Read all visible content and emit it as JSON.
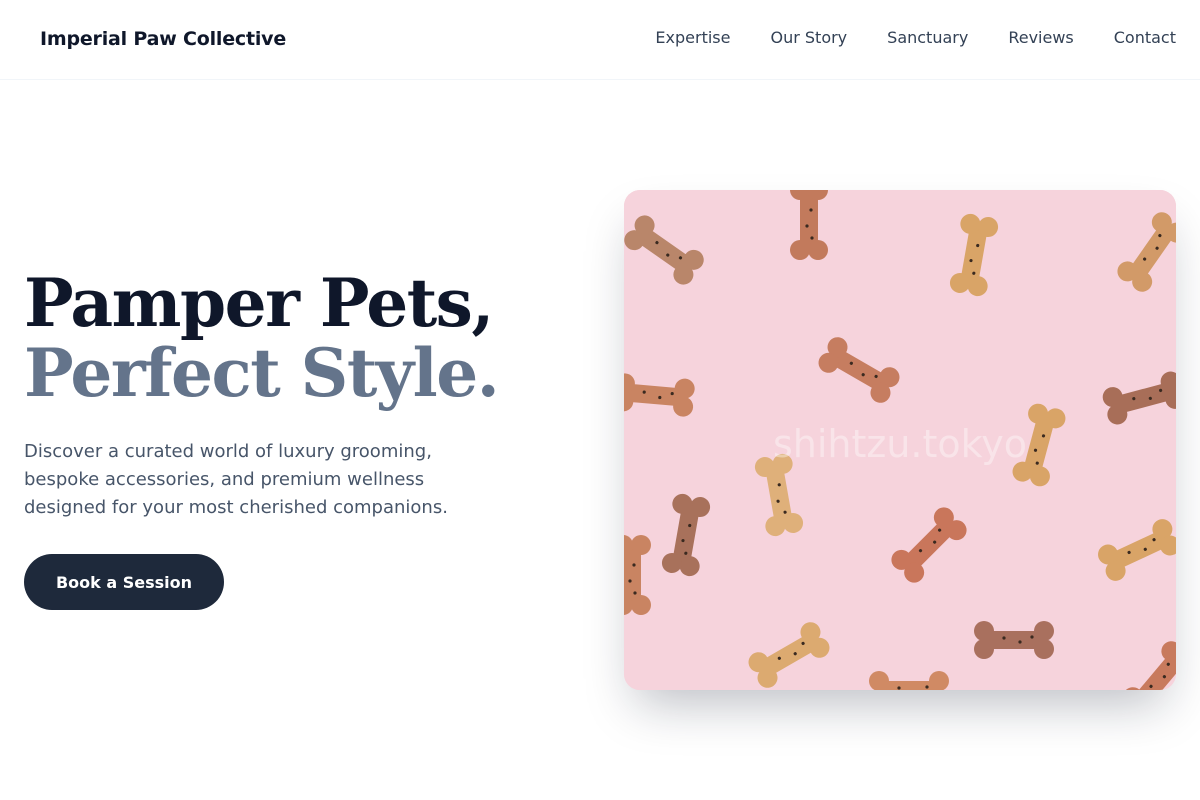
{
  "nav": {
    "brand": "Imperial Paw Collective",
    "links": [
      {
        "label": "Expertise"
      },
      {
        "label": "Our Story"
      },
      {
        "label": "Sanctuary"
      },
      {
        "label": "Reviews"
      },
      {
        "label": "Contact"
      }
    ]
  },
  "hero": {
    "title_line1": "Pamper Pets,",
    "title_line2": "Perfect Style.",
    "description": "Discover a curated world of luxury grooming, bespoke accessories, and premium wellness designed for your most cherished companions.",
    "cta_label": "Book a Session",
    "image": {
      "alt": "Dog bone biscuits scattered on a pink background",
      "watermark": "shihtzu.tokyo",
      "background_color": "#f6d3dc"
    }
  },
  "colors": {
    "heading_dark": "#0f172a",
    "heading_muted": "#64748b",
    "body_text": "#475569",
    "cta_background": "#1e293b"
  }
}
